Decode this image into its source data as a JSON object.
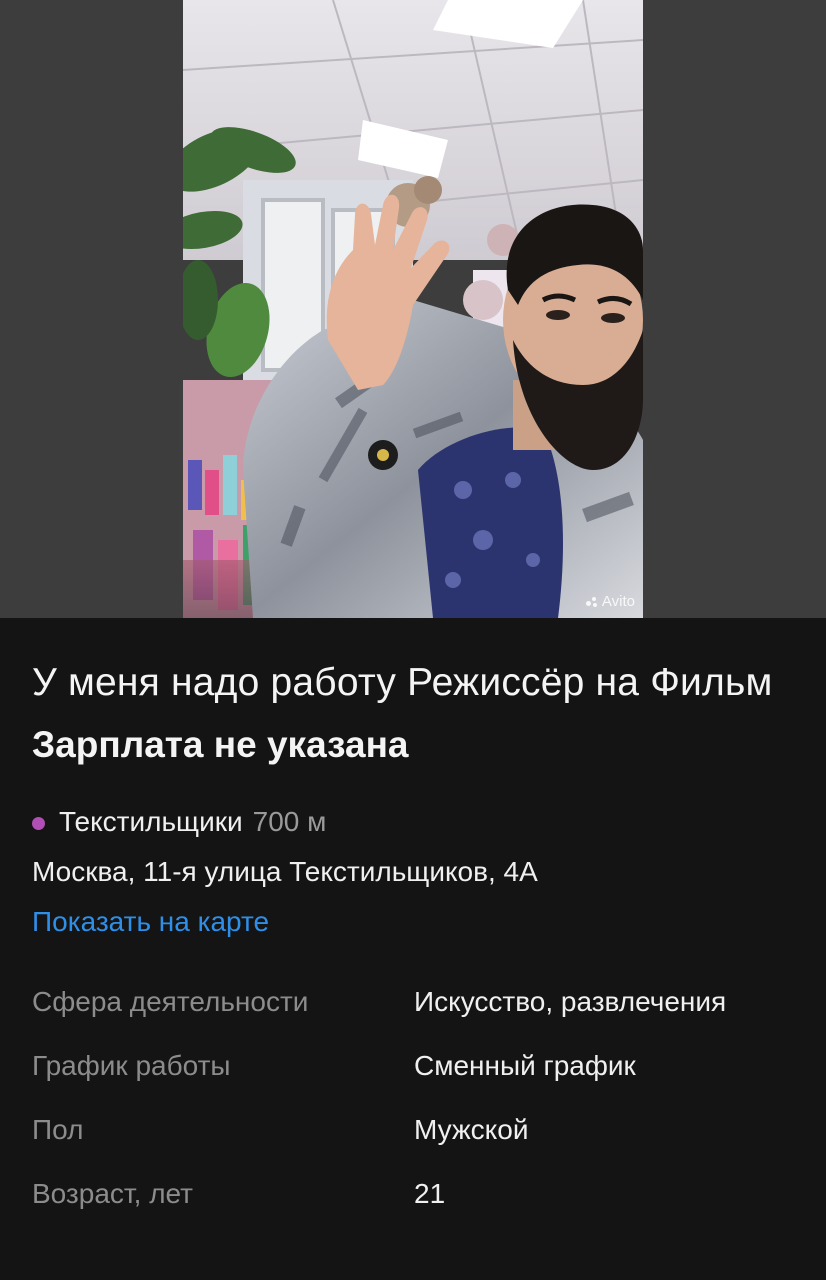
{
  "photo": {
    "watermark": "Avito"
  },
  "listing": {
    "title": "У меня надо работу Режиссёр на Фильм",
    "salary": "Зарплата не указана",
    "metro_station": "Текстильщики",
    "metro_distance": "700 м",
    "metro_line_color": "#b14fb6",
    "address": "Москва, 11-я улица Текстильщиков, 4А",
    "map_link": "Показать на карте"
  },
  "params": [
    {
      "label": "Сфера деятельности",
      "value": "Искусство, развлечения"
    },
    {
      "label": "График работы",
      "value": "Сменный график"
    },
    {
      "label": "Пол",
      "value": "Мужской"
    },
    {
      "label": "Возраст, лет",
      "value": "21"
    }
  ],
  "colors": {
    "background": "#141414",
    "link": "#2f8fe8",
    "muted": "#8c8c8c"
  }
}
